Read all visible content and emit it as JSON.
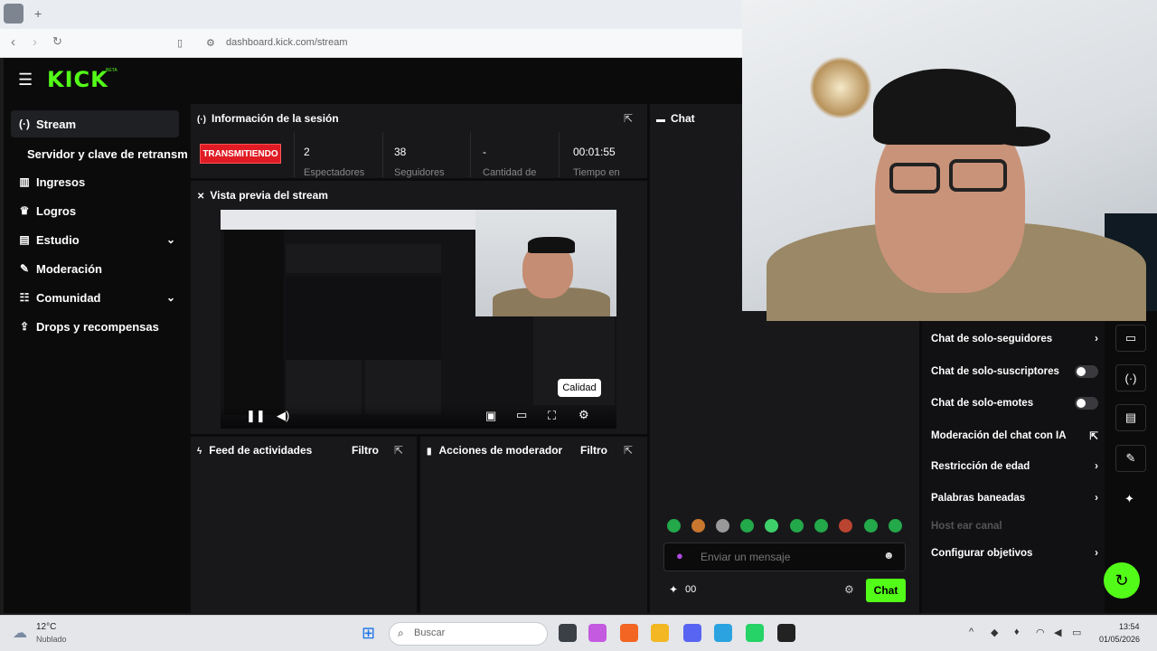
{
  "browser": {
    "url": "dashboard.kick.com/stream",
    "tab_new": "+"
  },
  "brand": {
    "logo": "KICK",
    "beta": "BETA"
  },
  "sidebar": {
    "items": [
      {
        "label": "Stream",
        "icon": "signal-icon"
      },
      {
        "label": "Servidor y clave de retransm",
        "icon": ""
      },
      {
        "label": "Ingresos",
        "icon": "chart-icon"
      },
      {
        "label": "Logros",
        "icon": "trophy-icon"
      },
      {
        "label": "Estudio",
        "icon": "studio-icon"
      },
      {
        "label": "Moderación",
        "icon": "wrench-icon"
      },
      {
        "label": "Comunidad",
        "icon": "people-icon"
      },
      {
        "label": "Drops y recompensas",
        "icon": "gift-icon"
      }
    ]
  },
  "session": {
    "title": "Información de la sesión",
    "status": "TRANSMITIENDO",
    "stats": [
      {
        "value": "2",
        "label": "Espectadores"
      },
      {
        "value": "38",
        "label": "Seguidores"
      },
      {
        "value": "-",
        "label": "Cantidad de"
      },
      {
        "value": "00:01:55",
        "label": "Tiempo en"
      }
    ]
  },
  "preview": {
    "title": "Vista previa del stream",
    "tooltip": "Calidad"
  },
  "feed": {
    "title": "Feed de actividades",
    "filter": "Filtro"
  },
  "mod_actions": {
    "title": "Acciones de moderador",
    "filter": "Filtro"
  },
  "chat": {
    "title": "Chat",
    "placeholder": "Enviar un mensaje",
    "send": "Chat",
    "points": "00"
  },
  "mod_settings": {
    "rows": [
      {
        "label": "Chat de solo-seguidores",
        "control": "chevron"
      },
      {
        "label": "Chat de solo-suscriptores",
        "control": "toggle"
      },
      {
        "label": "Chat de solo-emotes",
        "control": "toggle"
      },
      {
        "label": "Moderación del chat con IA",
        "control": "external"
      },
      {
        "label": "Restricción de edad",
        "control": "chevron"
      },
      {
        "label": "Palabras baneadas",
        "control": "chevron"
      },
      {
        "label": "Host ear canal",
        "control": "none"
      },
      {
        "label": "Configurar objetivos",
        "control": "chevron"
      }
    ]
  },
  "taskbar": {
    "temp": "12°C",
    "weather": "Nublado",
    "search": "Buscar",
    "time": "13:54",
    "date": "01/05/2026"
  }
}
